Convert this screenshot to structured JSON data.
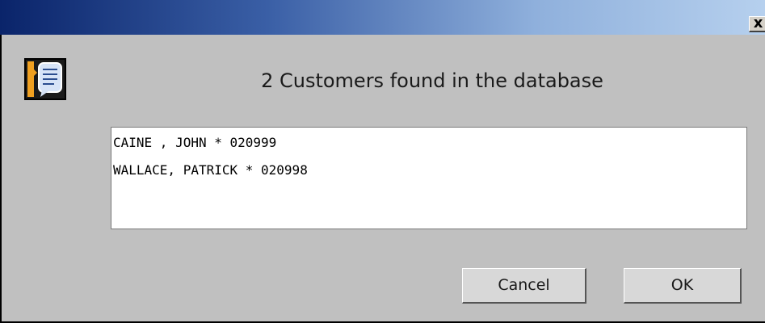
{
  "window": {
    "title": "",
    "close_glyph": "x"
  },
  "dialog": {
    "icon": "chat-document-icon",
    "message": "2 Customers found in the database",
    "results": [
      "CAINE , JOHN * 020999",
      "WALLACE, PATRICK * 020998"
    ]
  },
  "buttons": {
    "cancel_label": "Cancel",
    "ok_label": "OK"
  },
  "colors": {
    "titlebar_start": "#0a246a",
    "titlebar_end": "#b6d0ee",
    "dialog_bg": "#c0c0c0",
    "icon_accent": "#f0a020"
  }
}
